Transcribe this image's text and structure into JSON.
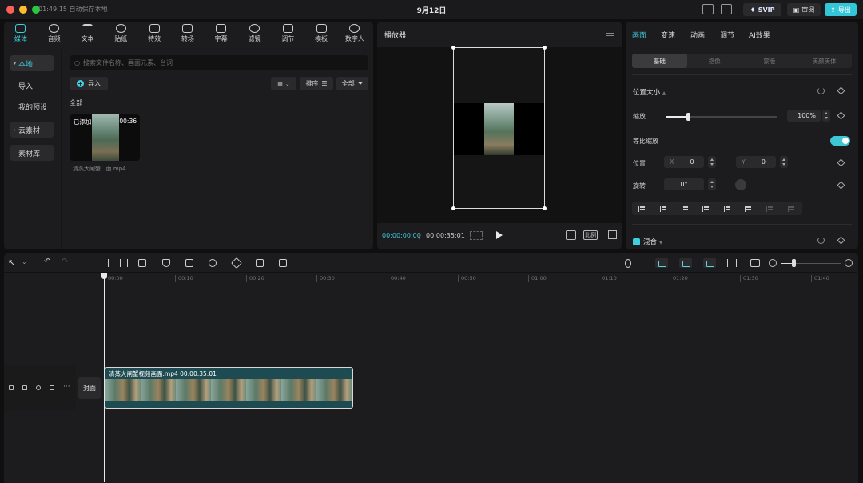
{
  "titlebar": {
    "autosave": "01:49:15 自动保存本地",
    "title": "9月12日",
    "svip": "SVIP",
    "review": "审阅",
    "export": "导出",
    "colors": {
      "close": "#ff5f57",
      "min": "#febc2e",
      "max": "#28c840",
      "accent": "#33c5d8"
    }
  },
  "media": {
    "tools": [
      {
        "label": "媒体",
        "icon": "media-icon"
      },
      {
        "label": "音频",
        "icon": "audio-icon"
      },
      {
        "label": "文本",
        "icon": "text-icon"
      },
      {
        "label": "贴纸",
        "icon": "sticker-icon"
      },
      {
        "label": "特效",
        "icon": "effects-icon"
      },
      {
        "label": "转场",
        "icon": "transition-icon"
      },
      {
        "label": "字幕",
        "icon": "subtitle-icon"
      },
      {
        "label": "滤镜",
        "icon": "filter-icon"
      },
      {
        "label": "调节",
        "icon": "adjust-icon"
      },
      {
        "label": "模板",
        "icon": "template-icon"
      },
      {
        "label": "数字人",
        "icon": "avatar-icon"
      }
    ],
    "sidebar": {
      "local": "本地",
      "import": "导入",
      "presets": "我的预设",
      "cloud": "云素材",
      "library": "素材库"
    },
    "search_placeholder": "搜索文件名称、画面元素、台词",
    "import_button": "导入",
    "sort_button": "排序",
    "all_button": "全部",
    "section_label": "全部",
    "item": {
      "added": "已添加",
      "duration": "00:36",
      "name": "清蒸大闸蟹...面.mp4"
    }
  },
  "player": {
    "title": "播放器",
    "current_time": "00:00:00:00",
    "total_time": "00:00:35:01",
    "ratio_button": "比例"
  },
  "properties": {
    "tabs": [
      "画面",
      "变速",
      "动画",
      "调节",
      "AI效果"
    ],
    "subtabs": [
      "基础",
      "抠像",
      "蒙版",
      "美颜美体"
    ],
    "position_size": "位置大小",
    "scale_label": "缩放",
    "scale_value": "100%",
    "scale_fraction": 0.2,
    "uniform_scale": "等比缩放",
    "position_label": "位置",
    "x_label": "X",
    "x_value": "0",
    "y_label": "Y",
    "y_value": "0",
    "rotation_label": "旋转",
    "rotation_value": "0°",
    "blend": "混合"
  },
  "timeline": {
    "ruler": [
      "00:00",
      "00:10",
      "00:20",
      "00:30",
      "00:40",
      "00:50",
      "01:00",
      "01:10",
      "01:20",
      "01:30",
      "01:40"
    ],
    "cover": "封面",
    "clip_label": "清蒸大闸蟹视频画面.mp4  00:00:35:01"
  }
}
